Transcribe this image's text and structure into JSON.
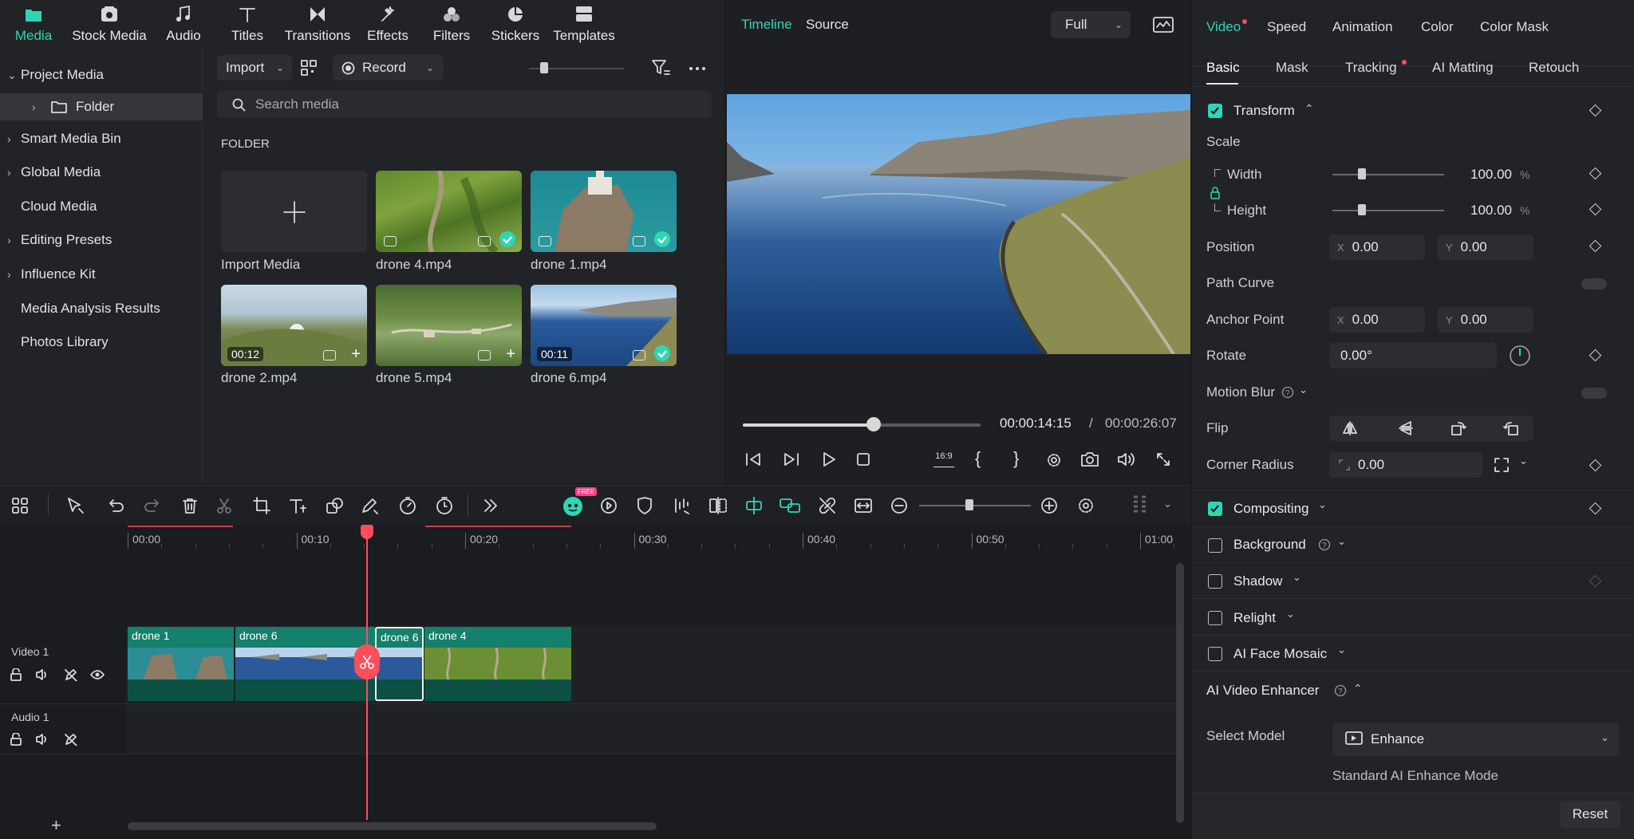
{
  "top_tabs": [
    {
      "label": "Media",
      "icon": "media-icon",
      "active": true
    },
    {
      "label": "Stock Media",
      "icon": "stock-media-icon"
    },
    {
      "label": "Audio",
      "icon": "audio-icon"
    },
    {
      "label": "Titles",
      "icon": "titles-icon"
    },
    {
      "label": "Transitions",
      "icon": "transitions-icon"
    },
    {
      "label": "Effects",
      "icon": "effects-icon"
    },
    {
      "label": "Filters",
      "icon": "filters-icon"
    },
    {
      "label": "Stickers",
      "icon": "stickers-icon"
    },
    {
      "label": "Templates",
      "icon": "templates-icon"
    }
  ],
  "sidebar": {
    "items": [
      {
        "label": "Project Media",
        "chevron": "⌄"
      },
      {
        "label": "Folder",
        "chevron": "›"
      },
      {
        "label": "Smart Media Bin",
        "chevron": "›"
      },
      {
        "label": "Global Media",
        "chevron": "›"
      },
      {
        "label": "Cloud Media",
        "chevron": ""
      },
      {
        "label": "Editing Presets",
        "chevron": "›"
      },
      {
        "label": "Influence Kit",
        "chevron": "›"
      },
      {
        "label": "Media Analysis Results",
        "chevron": ""
      },
      {
        "label": "Photos Library",
        "chevron": ""
      }
    ]
  },
  "media": {
    "import_label": "Import",
    "record_label": "Record",
    "search_placeholder": "Search media",
    "section_title": "FOLDER",
    "import_media_label": "Import Media",
    "items": [
      {
        "name": "drone 4.mp4",
        "duration": "",
        "status": "check"
      },
      {
        "name": "drone 1.mp4",
        "duration": "",
        "status": "check"
      },
      {
        "name": "drone 2.mp4",
        "duration": "00:12",
        "status": "add"
      },
      {
        "name": "drone 5.mp4",
        "duration": "",
        "status": "add"
      },
      {
        "name": "drone 6.mp4",
        "duration": "00:11",
        "status": "check"
      }
    ]
  },
  "preview": {
    "tab_timeline": "Timeline",
    "tab_source": "Source",
    "quality": "Full",
    "current_time": "00:00:14:15",
    "separator": "/",
    "total_time": "00:00:26:07",
    "progress": 0.55,
    "aspect": "16:9"
  },
  "inspector": {
    "tabs": [
      {
        "label": "Video",
        "dot": true,
        "active": true
      },
      {
        "label": "Speed",
        "dot": false
      },
      {
        "label": "Animation",
        "dot": false
      },
      {
        "label": "Color",
        "dot": false
      },
      {
        "label": "Color Mask",
        "dot": false
      }
    ],
    "subtabs": [
      {
        "label": "Basic",
        "active": true
      },
      {
        "label": "Mask"
      },
      {
        "label": "Tracking",
        "dot": true
      },
      {
        "label": "AI Matting"
      },
      {
        "label": "Retouch"
      }
    ],
    "transform_label": "Transform",
    "scale_label": "Scale",
    "width_label": "Width",
    "width_value": "100.00",
    "height_label": "Height",
    "height_value": "100.00",
    "percent": "%",
    "position_label": "Position",
    "pos_x": "0.00",
    "pos_y": "0.00",
    "path_curve_label": "Path Curve",
    "anchor_label": "Anchor Point",
    "anchor_x": "0.00",
    "anchor_y": "0.00",
    "rotate_label": "Rotate",
    "rotate_value": "0.00°",
    "motion_blur_label": "Motion Blur",
    "flip_label": "Flip",
    "corner_radius_label": "Corner Radius",
    "corner_radius_value": "0.00",
    "x_label": "X",
    "y_label": "Y",
    "sections": [
      {
        "label": "Compositing",
        "checked": true
      },
      {
        "label": "Background",
        "checked": false
      },
      {
        "label": "Shadow",
        "checked": false
      },
      {
        "label": "Relight",
        "checked": false
      },
      {
        "label": "AI Face Mosaic",
        "checked": false
      }
    ],
    "ai_enhancer_label": "AI Video Enhancer",
    "select_model_label": "Select Model",
    "model_value": "Enhance",
    "model_desc": "Standard AI Enhance Mode",
    "reset_label": "Reset"
  },
  "timeline": {
    "ruler": [
      "00:00",
      "00:10",
      "00:20",
      "00:30",
      "00:40",
      "00:50",
      "01:00"
    ],
    "tracks": [
      {
        "label": "Video 1"
      },
      {
        "label": "Audio 1"
      }
    ],
    "clips": [
      "drone 1",
      "drone 6",
      "drone 6",
      "drone 4"
    ],
    "playhead_time_fraction": 0.2366,
    "zoom_level": 0.45,
    "free_badge": "FREE"
  },
  "colors": {
    "accent": "#2fd6b4",
    "playhead": "#ff4d5a",
    "clip": "#15806b"
  }
}
